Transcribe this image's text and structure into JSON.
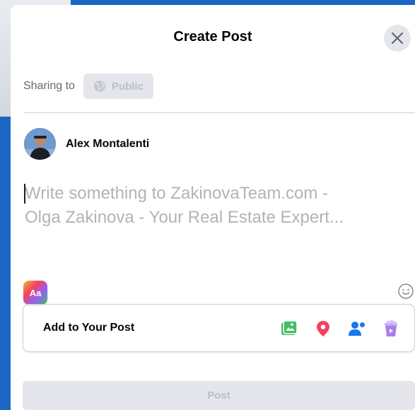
{
  "header": {
    "title": "Create Post",
    "close_icon": "close-icon"
  },
  "sharing": {
    "label": "Sharing to",
    "audience": "Public",
    "audience_icon": "globe-icon"
  },
  "author": {
    "name": "Alex Montalenti"
  },
  "composer": {
    "placeholder_line1": "Write something to ZakinovaTeam.com -",
    "placeholder_line2": "Olga Zakinova - Your Real Estate Expert..."
  },
  "tools": {
    "text_format_label": "Aa",
    "emoji_icon": "smiley-icon"
  },
  "add_to_post": {
    "label": "Add to Your Post",
    "icons": [
      "photo-video-icon",
      "location-pin-icon",
      "tag-people-icon",
      "gif-icon"
    ]
  },
  "post_button": {
    "label": "Post"
  },
  "colors": {
    "frame": "#1a66c2",
    "photo_green": "#45bd62",
    "location_red": "#f3425f",
    "tag_blue": "#1877f2",
    "gif_purple": "#a97ee9",
    "disabled_text": "#bcc0c4",
    "disabled_bg": "#e4e6eb"
  }
}
